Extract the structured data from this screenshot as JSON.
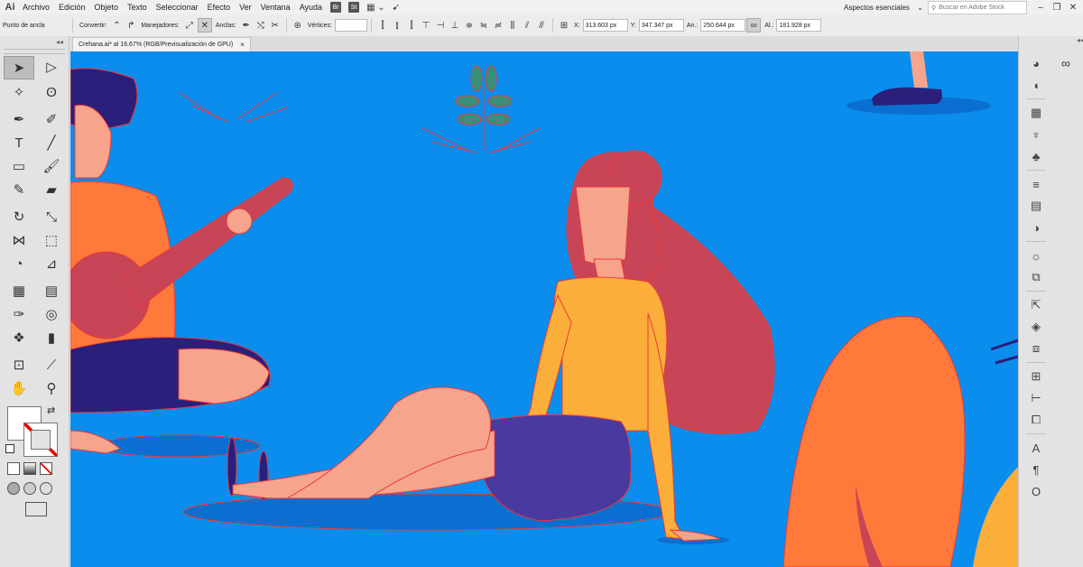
{
  "app": {
    "logo": "Ai",
    "menu": [
      "Archivo",
      "Edición",
      "Objeto",
      "Texto",
      "Seleccionar",
      "Efecto",
      "Ver",
      "Ventana",
      "Ayuda"
    ],
    "bridge_icon": "Br",
    "stock_icon": "St",
    "workspace": "Aspectos esenciales",
    "search_placeholder": "Buscar en Adobe Stock",
    "window_controls": [
      "–",
      "❐",
      "✕"
    ]
  },
  "control_bar": {
    "anchor_label": "Punto de ancla",
    "convert_label": "Convertir:",
    "handles_label": "Manejadores:",
    "anchors_label": "Anclas:",
    "vertices_label": "Vértices:",
    "x_label": "X:",
    "x_value": "313.603 px",
    "y_label": "Y:",
    "y_value": "347.347 px",
    "w_label": "An.:",
    "w_value": "250.644 px",
    "h_label": "Al.:",
    "h_value": "181.928 px"
  },
  "document": {
    "tab_title": "Crehana.ai* al 16.67% (RGB/Previsualización de GPU)",
    "close": "×"
  },
  "toolbox": {
    "collapse": "◂◂",
    "tools": [
      {
        "name": "selection-tool",
        "glyph": "➤"
      },
      {
        "name": "direct-selection-tool",
        "glyph": "▷"
      },
      {
        "name": "magic-wand-tool",
        "glyph": "✧"
      },
      {
        "name": "lasso-tool",
        "glyph": "ʘ"
      },
      {
        "name": "pen-tool",
        "glyph": "✒"
      },
      {
        "name": "curvature-tool",
        "glyph": "✐"
      },
      {
        "name": "type-tool",
        "glyph": "T"
      },
      {
        "name": "line-tool",
        "glyph": "╱"
      },
      {
        "name": "rectangle-tool",
        "glyph": "▭"
      },
      {
        "name": "paintbrush-tool",
        "glyph": "🖌"
      },
      {
        "name": "shaper-tool",
        "glyph": "✎"
      },
      {
        "name": "eraser-tool",
        "glyph": "▰"
      },
      {
        "name": "rotate-tool",
        "glyph": "↻"
      },
      {
        "name": "scale-tool",
        "glyph": "⤡"
      },
      {
        "name": "width-tool",
        "glyph": "⋈"
      },
      {
        "name": "free-transform-tool",
        "glyph": "⬚"
      },
      {
        "name": "shape-builder-tool",
        "glyph": "◔"
      },
      {
        "name": "perspective-grid-tool",
        "glyph": "⊿"
      },
      {
        "name": "mesh-tool",
        "glyph": "▦"
      },
      {
        "name": "gradient-tool",
        "glyph": "▤"
      },
      {
        "name": "eyedropper-tool",
        "glyph": "✑"
      },
      {
        "name": "blend-tool",
        "glyph": "◎"
      },
      {
        "name": "symbol-sprayer-tool",
        "glyph": "❖"
      },
      {
        "name": "column-graph-tool",
        "glyph": "▮"
      },
      {
        "name": "artboard-tool",
        "glyph": "⊡"
      },
      {
        "name": "slice-tool",
        "glyph": "⟋"
      },
      {
        "name": "hand-tool",
        "glyph": "✋"
      },
      {
        "name": "zoom-tool",
        "glyph": "⚲"
      }
    ],
    "swap_glyph": "⇄"
  },
  "right_panel": {
    "collapse": "◂◂",
    "icons": [
      {
        "name": "color-icon",
        "glyph": "◕"
      },
      {
        "name": "color-guide-icon",
        "glyph": "◖"
      },
      {
        "name": "swatches-icon",
        "glyph": "▦"
      },
      {
        "name": "brushes-icon",
        "glyph": "♆"
      },
      {
        "name": "symbols-icon",
        "glyph": "♣"
      },
      {
        "name": "stroke-icon",
        "glyph": "≡"
      },
      {
        "name": "gradient-icon",
        "glyph": "▤"
      },
      {
        "name": "transparency-icon",
        "glyph": "◑"
      },
      {
        "name": "appearance-icon",
        "glyph": "☼"
      },
      {
        "name": "graphic-styles-icon",
        "glyph": "⧉"
      },
      {
        "name": "export-icon",
        "glyph": "⇱"
      },
      {
        "name": "layers-icon",
        "glyph": "◈"
      },
      {
        "name": "artboards-icon",
        "glyph": "⧈"
      },
      {
        "name": "transform-icon",
        "glyph": "⊞"
      },
      {
        "name": "align-icon",
        "glyph": "⊢"
      },
      {
        "name": "pathfinder-icon",
        "glyph": "⧠"
      },
      {
        "name": "character-icon",
        "glyph": "A"
      },
      {
        "name": "paragraph-icon",
        "glyph": "¶"
      },
      {
        "name": "opentype-icon",
        "glyph": "O"
      }
    ],
    "cc_glyph": "∞"
  },
  "colors": {
    "canvas": "#0b8ded",
    "path_stroke": "#e83a3a",
    "skin": "#f7a48d",
    "hair": "#c84557",
    "top": "#fbae3a",
    "skirt": "#4a3aa0",
    "orange": "#ff7a3a"
  }
}
